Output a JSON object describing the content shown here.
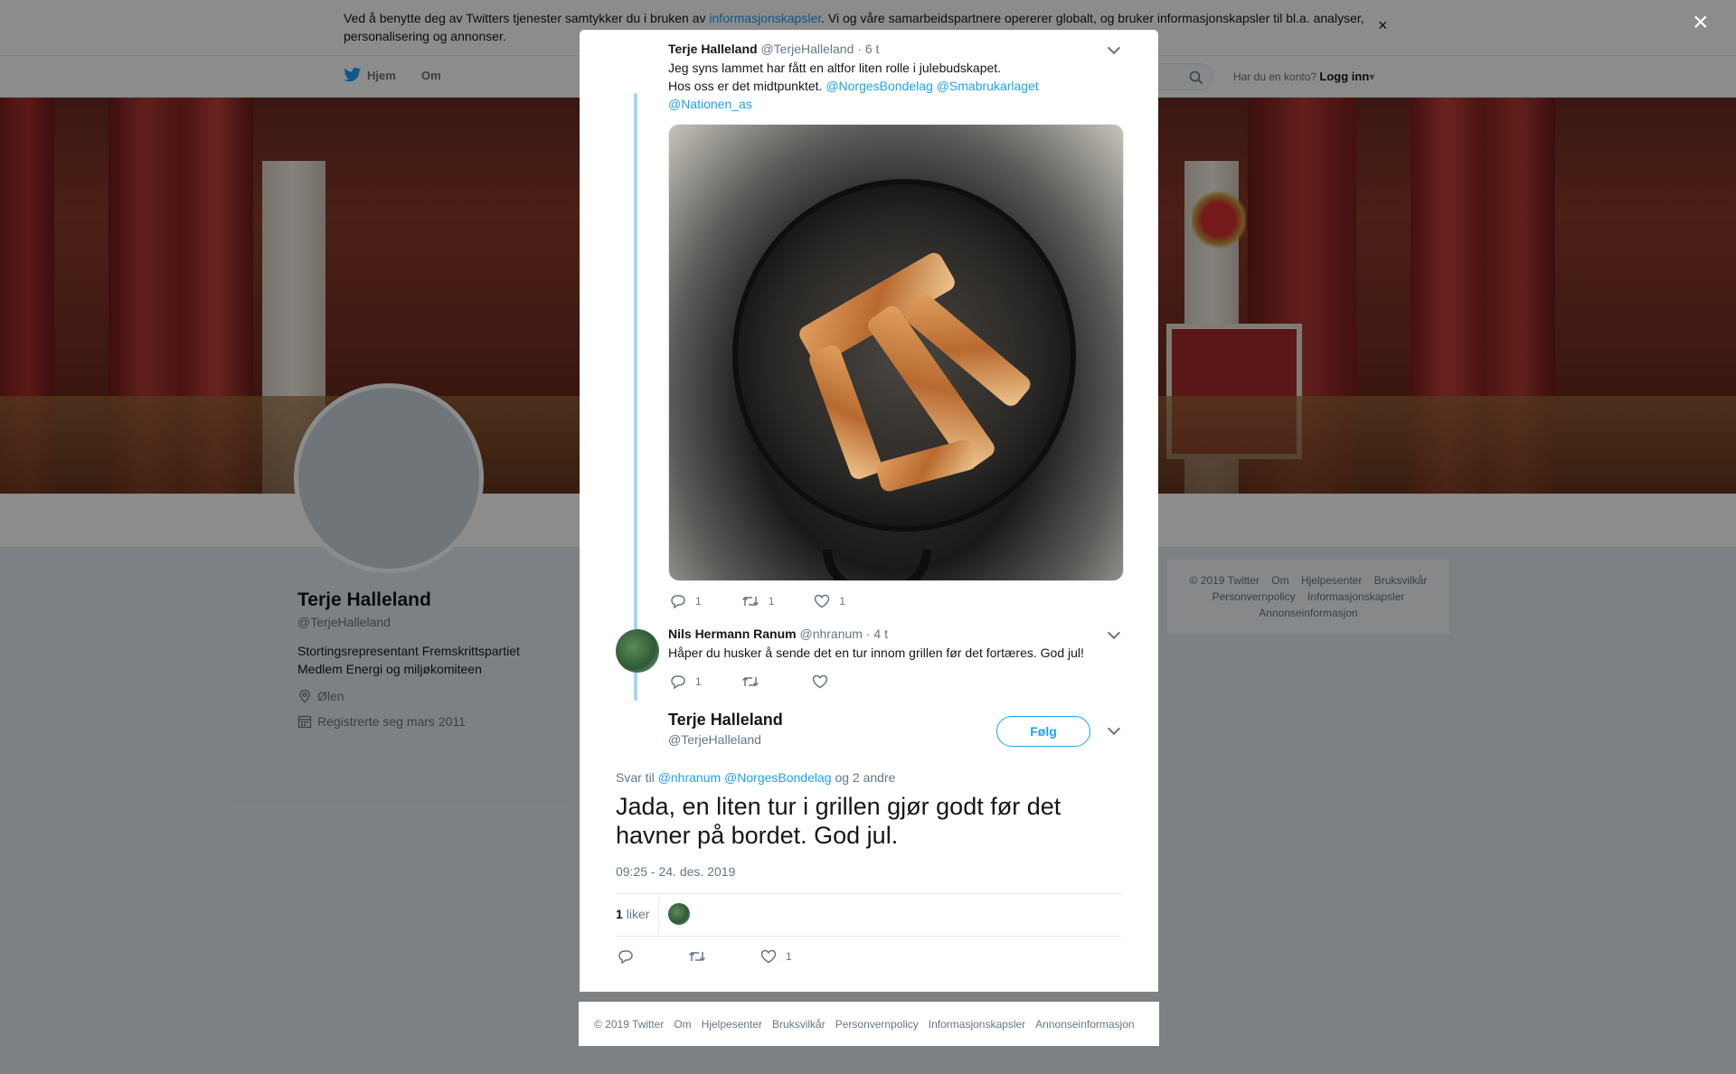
{
  "cookie_banner": {
    "text_before": "Ved å benytte deg av Twitters tjenester samtykker du i bruken av ",
    "link": "informasjonskapsler",
    "text_after": ". Vi og våre samarbeidspartnere opererer globalt, og bruker informasjonskapsler til bl.a. analyser, personalisering og annonser.",
    "close": "×"
  },
  "nav": {
    "home": "Hjem",
    "about": "Om",
    "login_prompt": "Har du en konto?",
    "login": "Logg inn"
  },
  "profile": {
    "name": "Terje Halleland",
    "handle": "@TerjeHalleland",
    "bio_line1": "Stortingsrepresentant Fremskrittspartiet",
    "bio_line2": "Medlem Energi og miljøkomiteen",
    "location": "Ølen",
    "joined": "Registrerte seg mars 2011"
  },
  "side_footer": {
    "links": [
      "© 2019 Twitter",
      "Om",
      "Hjelpesenter",
      "Bruksvilkår",
      "Personvernpolicy",
      "Informasjonskapsler",
      "Annonseinformasjon"
    ]
  },
  "overlay": {
    "close": "×"
  },
  "tweet1": {
    "name": "Terje Halleland",
    "handle": "@TerjeHalleland",
    "time": "· 6 t",
    "line1": "Jeg syns lammet har fått en altfor liten rolle i julebudskapet.",
    "line2": "Hos oss er det midtpunktet.",
    "mention1": "@NorgesBondelag",
    "mention2": "@Smabrukarlaget",
    "mention3": "@Nationen_as",
    "replies": "1",
    "retweets": "1",
    "likes": "1"
  },
  "tweet2": {
    "name": "Nils Hermann Ranum",
    "handle": "@nhranum",
    "time": "· 4 t",
    "text": "Håper du husker å sende det en tur innom grillen før det fortæres. God jul!",
    "replies": "1"
  },
  "main_tweet": {
    "name": "Terje Halleland",
    "handle": "@TerjeHalleland",
    "follow": "Følg",
    "reply_prefix": "Svar til",
    "reply_m1": "@nhranum",
    "reply_m2": "@NorgesBondelag",
    "reply_suffix": "og 2 andre",
    "text": "Jada, en liten tur i grillen gjør godt før det havner på bordet. God jul.",
    "timestamp": "09:25 - 24. des. 2019",
    "like_count": "1",
    "like_label": "liker",
    "likes": "1"
  },
  "modal_footer": {
    "links": [
      "© 2019 Twitter",
      "Om",
      "Hjelpesenter",
      "Bruksvilkår",
      "Personvernpolicy",
      "Informasjonskapsler",
      "Annonseinformasjon"
    ]
  },
  "colors": {
    "accent": "#1da1f2",
    "thread": "#a3d6f9",
    "muted": "#657786"
  }
}
